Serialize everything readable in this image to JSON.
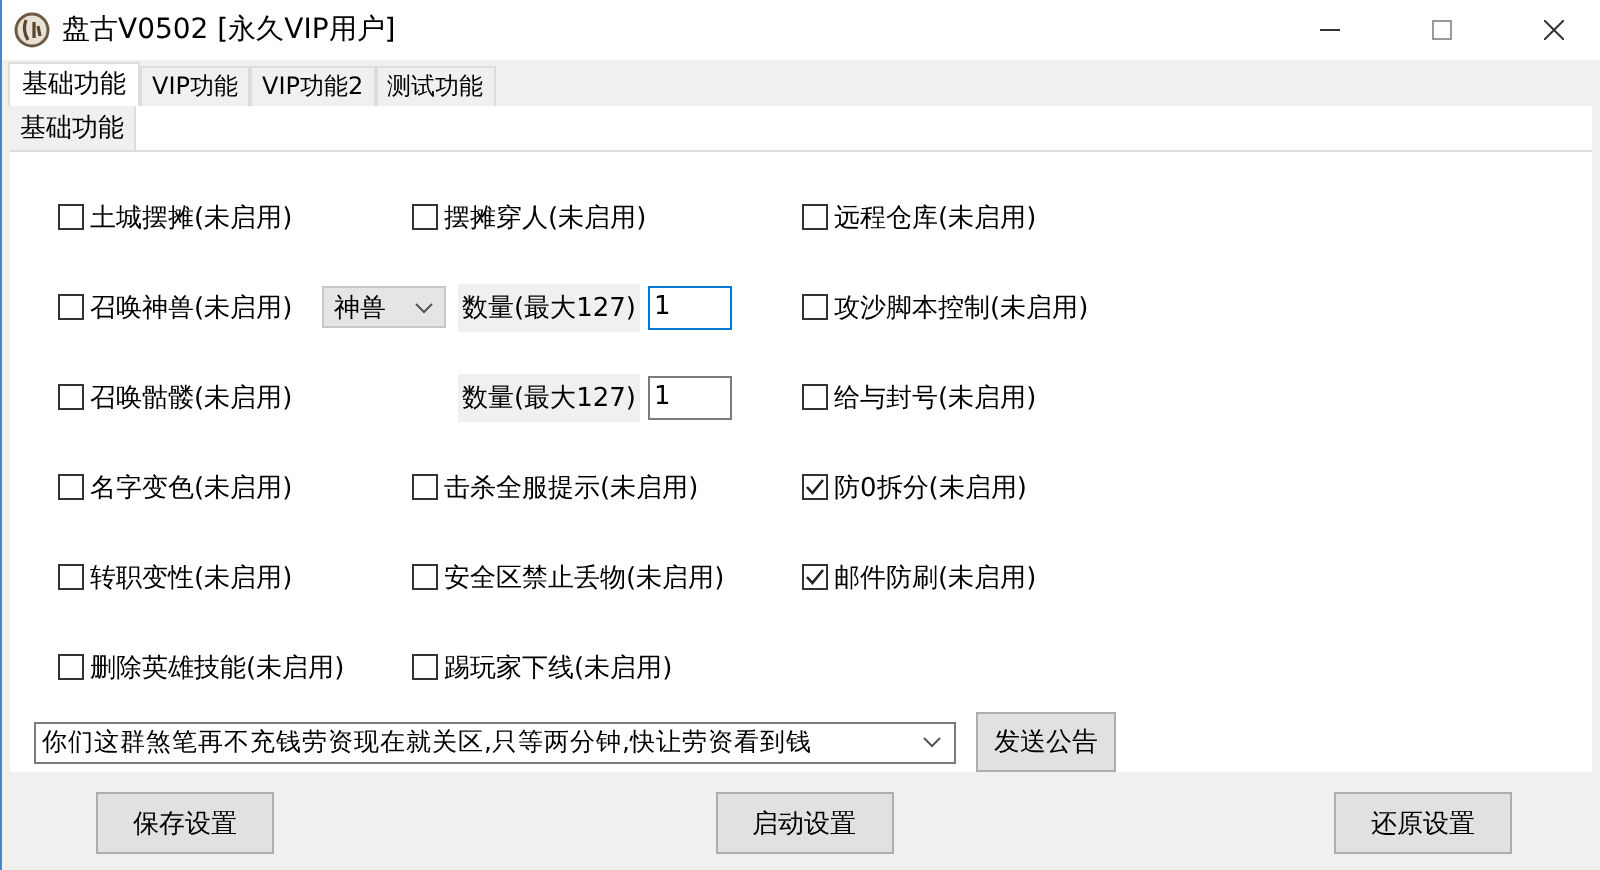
{
  "window": {
    "title": "盘古V0502 [永久VIP用户]"
  },
  "tabs": [
    {
      "label": "基础功能",
      "selected": true
    },
    {
      "label": "VIP功能",
      "selected": false
    },
    {
      "label": "VIP功能2",
      "selected": false
    },
    {
      "label": "测试功能",
      "selected": false
    }
  ],
  "subtabs": [
    {
      "label": "基础功能"
    }
  ],
  "rows": [
    {
      "items": [
        {
          "kind": "checkbox",
          "label": "土城摆摊(未启用)",
          "checked": false
        },
        {
          "kind": "checkbox",
          "label": "摆摊穿人(未启用)",
          "checked": false
        },
        {
          "kind": "checkbox",
          "label": "远程仓库(未启用)",
          "checked": false
        }
      ]
    },
    {
      "items": [
        {
          "kind": "checkbox",
          "label": "召唤神兽(未启用)",
          "checked": false
        },
        {
          "kind": "combo",
          "value": "神兽"
        },
        {
          "kind": "qty",
          "label": "数量(最大127)",
          "value": "1",
          "focused": true
        },
        {
          "kind": "checkbox",
          "label": "攻沙脚本控制(未启用)",
          "checked": false
        }
      ]
    },
    {
      "items": [
        {
          "kind": "checkbox",
          "label": "召唤骷髅(未启用)",
          "checked": false
        },
        {
          "kind": "qty",
          "label": "数量(最大127)",
          "value": "1",
          "focused": false
        },
        {
          "kind": "checkbox",
          "label": "给与封号(未启用)",
          "checked": false
        }
      ]
    },
    {
      "items": [
        {
          "kind": "checkbox",
          "label": "名字变色(未启用)",
          "checked": false
        },
        {
          "kind": "checkbox",
          "label": "击杀全服提示(未启用)",
          "checked": false
        },
        {
          "kind": "checkbox",
          "label": "防0拆分(未启用)",
          "checked": true
        }
      ]
    },
    {
      "items": [
        {
          "kind": "checkbox",
          "label": "转职变性(未启用)",
          "checked": false
        },
        {
          "kind": "checkbox",
          "label": "安全区禁止丢物(未启用)",
          "checked": false
        },
        {
          "kind": "checkbox",
          "label": "邮件防刷(未启用)",
          "checked": true
        }
      ]
    },
    {
      "items": [
        {
          "kind": "checkbox",
          "label": "删除英雄技能(未启用)",
          "checked": false
        },
        {
          "kind": "checkbox",
          "label": "踢玩家下线(未启用)",
          "checked": false
        }
      ]
    }
  ],
  "announcement": {
    "value": "你们这群煞笔再不充钱劳资现在就关区,只等两分钟,快让劳资看到钱",
    "button": "发送公告"
  },
  "buttons": [
    "保存设置",
    "启动设置",
    "还原设置"
  ]
}
